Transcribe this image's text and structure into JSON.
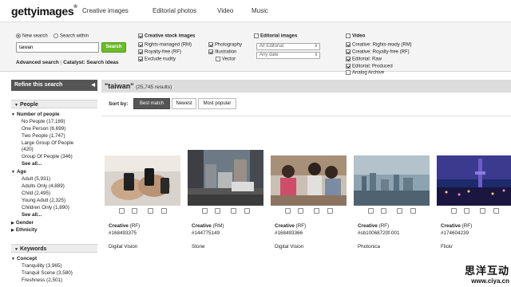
{
  "header": {
    "logo": "gettyimages",
    "logo_mark": "®",
    "nav": [
      "Creative images",
      "Editorial photos",
      "Video",
      "Music"
    ]
  },
  "search": {
    "scope_new": "New search",
    "scope_within": "Search within",
    "query": "taiwan",
    "button": "Search",
    "advanced": "Advanced search",
    "separator": "|",
    "catalyst": "Catalyst: Search ideas"
  },
  "creative_stock": {
    "title": "Creative stock images",
    "items": [
      "Rights-managed (RM)",
      "Royalty-free (RF)",
      "Exclude nudity",
      "Photography",
      "Illustration",
      "Vector"
    ]
  },
  "editorial": {
    "title": "Editorial images",
    "select1": "All Editorial",
    "select2": "Any date"
  },
  "video": {
    "title": "Video",
    "items": [
      "Creative: Rights-ready (RM)",
      "Creative: Royalty-free (RF)",
      "Editorial: Raw",
      "Editorial: Produced",
      "Analog Archive"
    ]
  },
  "sidebar": {
    "refine": "Refine this search",
    "people_head": "People",
    "people_sub": "Number of people",
    "people_items": [
      "No People (17,169)",
      "One Person (6,699)",
      "Two People (1,747)",
      "Large Group Of People",
      "(420)",
      "Group Of People (346)"
    ],
    "see_all": "See all...",
    "age_head": "Age",
    "age_items": [
      "Adult (5,931)",
      "Adults Only (4,889)",
      "Child (2,495)",
      "Young Adult (2,325)",
      "Children Only (1,890)"
    ],
    "gender": "Gender",
    "ethnicity": "Ethnicity",
    "keywords_head": "Keywords",
    "concept": "Concept",
    "concept_items": [
      "Tranquility (3,965)",
      "Tranquil Scene (3,580)",
      "Freshness (2,501)"
    ]
  },
  "results": {
    "query_title": "taiwan",
    "open_quote": "\"",
    "close_quote": "\"",
    "count": "(25,745 results)",
    "sort_label": "Sort by:",
    "sort_options": [
      "Best match",
      "Newest",
      "Most popular"
    ]
  },
  "cards": [
    {
      "type": "Creative",
      "license": "(RF)",
      "id": "#168493375",
      "collection": "Digital Vision"
    },
    {
      "type": "Creative",
      "license": "(RM)",
      "id": "#144775149",
      "collection": "Stone"
    },
    {
      "type": "Creative",
      "license": "(RF)",
      "id": "#168493366",
      "collection": "Digital Vision"
    },
    {
      "type": "Creative",
      "license": "(RF)",
      "id": "#sb10068720f-001",
      "collection": "Photonica"
    },
    {
      "type": "Creative",
      "license": "(RF)",
      "id": "#174604239",
      "collection": "Flickr"
    }
  ],
  "watermark": {
    "line1": "思洋互动",
    "line2": "www.ciya.cn"
  },
  "colors": {
    "search_button": "#6cbb2a",
    "refine_bg": "#555555",
    "results_bar": "#dddddd"
  }
}
